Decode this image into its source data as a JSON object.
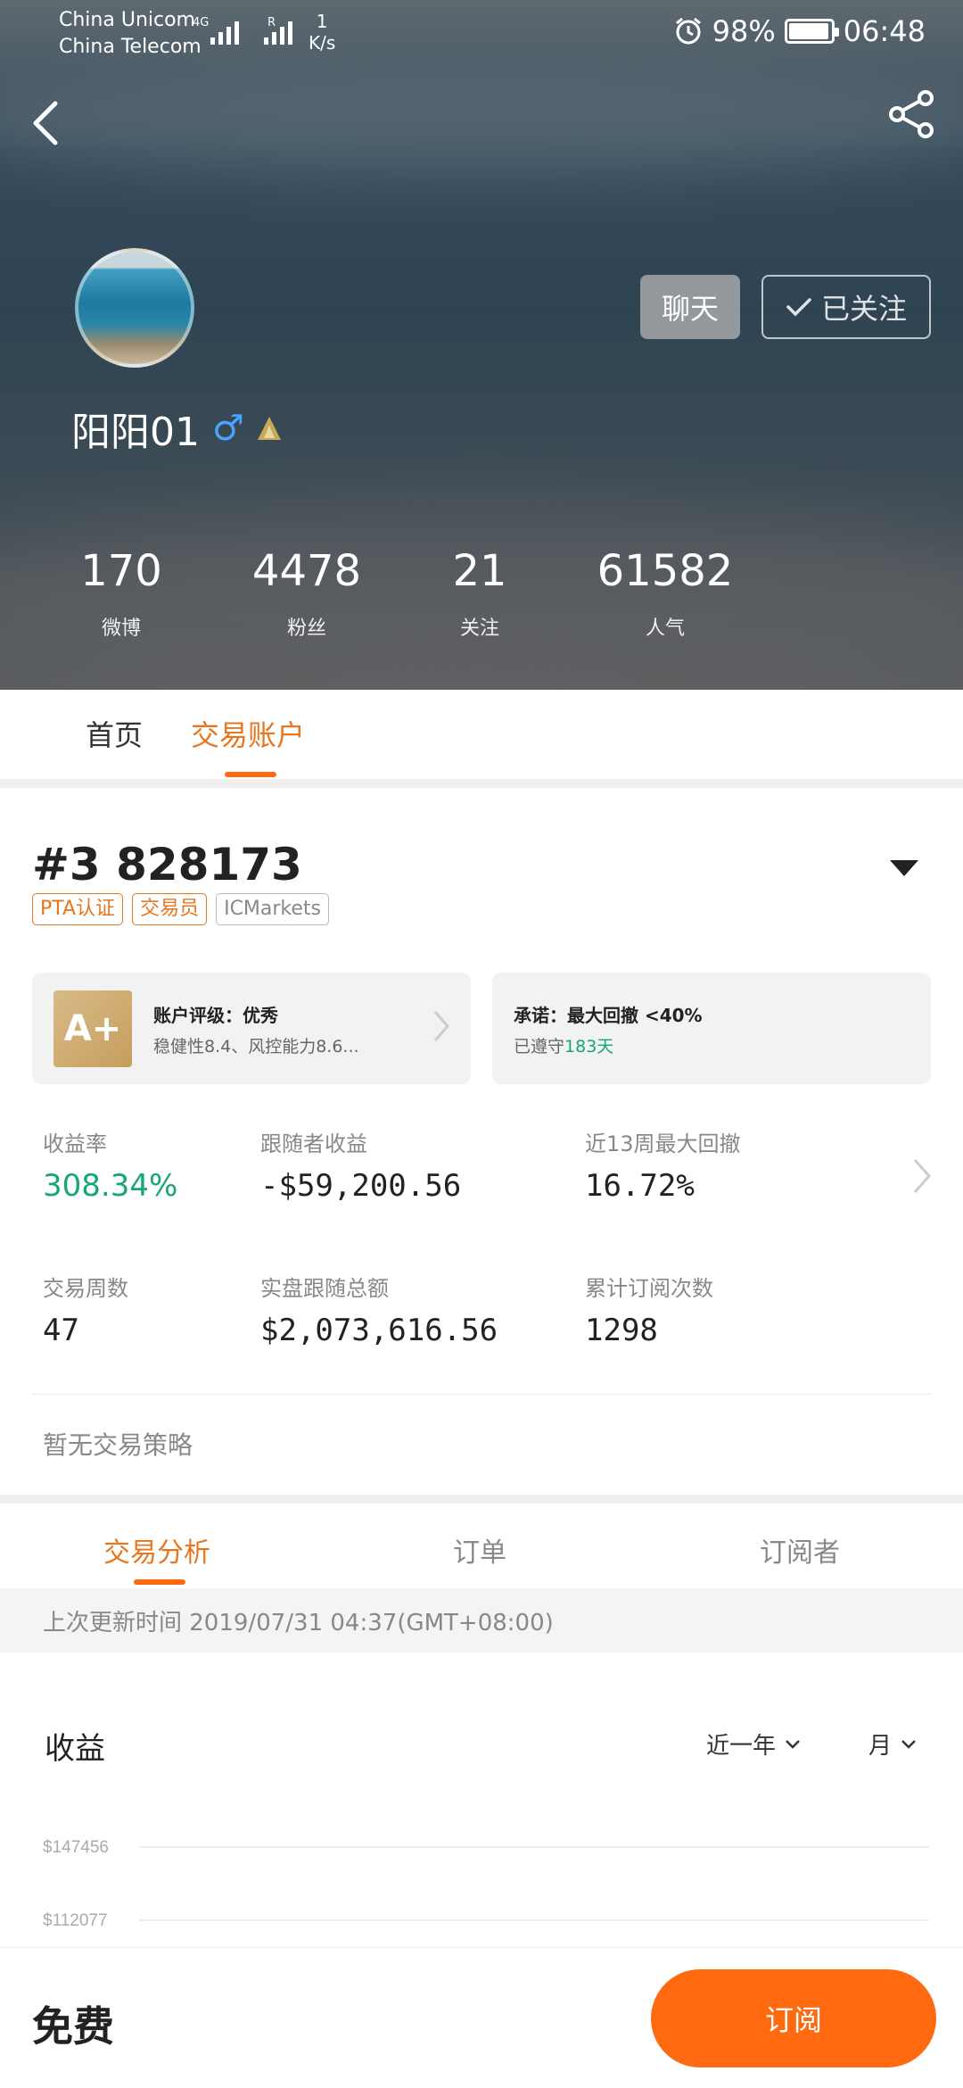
{
  "status_bar": {
    "carrier_1": "China Unicom",
    "carrier_2": "China Telecom",
    "net_tag_1": "4G",
    "net_tag_2": "R",
    "speed_value": "1",
    "speed_unit": "K/s",
    "battery": "98%",
    "time": "06:48"
  },
  "profile": {
    "name": "阳阳01",
    "gender_symbol": "♂",
    "chat_label": "聊天",
    "follow_label": "已关注",
    "stats": [
      {
        "value": "170",
        "label": "微博"
      },
      {
        "value": "4478",
        "label": "粉丝"
      },
      {
        "value": "21",
        "label": "关注"
      },
      {
        "value": "61582",
        "label": "人气"
      }
    ]
  },
  "top_tabs": [
    {
      "label": "首页",
      "active": false
    },
    {
      "label": "交易账户",
      "active": true
    }
  ],
  "account": {
    "title": "#3 828173",
    "tags": [
      "PTA认证",
      "交易员",
      "ICMarkets"
    ],
    "rating_card": {
      "badge": "A+",
      "title": "账户评级：优秀",
      "subtitle": "稳健性8.4、风控能力8.6..."
    },
    "promise_card": {
      "title": "承诺：最大回撤 <40%",
      "subtitle_prefix": "已遵守",
      "subtitle_days": "183天"
    },
    "metrics": [
      {
        "label": "收益率",
        "value": "308.34%"
      },
      {
        "label": "跟随者收益",
        "value": "-$59,200.56"
      },
      {
        "label": "近13周最大回撤",
        "value": "16.72%"
      },
      {
        "label": "交易周数",
        "value": "47"
      },
      {
        "label": "实盘跟随总额",
        "value": "$2,073,616.56"
      },
      {
        "label": "累计订阅次数",
        "value": "1298"
      }
    ],
    "strategy_text": "暂无交易策略"
  },
  "lower_tabs": [
    {
      "label": "交易分析",
      "active": true
    },
    {
      "label": "订单",
      "active": false
    },
    {
      "label": "订阅者",
      "active": false
    }
  ],
  "update_time": "上次更新时间 2019/07/31 04:37(GMT+08:00)",
  "chart_section": {
    "title": "收益",
    "range_select": "近一年",
    "period_select": "月",
    "y_labels": [
      "$147456",
      "$112077"
    ]
  },
  "bottom": {
    "price": "免费",
    "subscribe_label": "订阅"
  },
  "colors": {
    "accent": "#ff6a10",
    "accent_text": "#e8761e",
    "positive": "#17a776"
  }
}
